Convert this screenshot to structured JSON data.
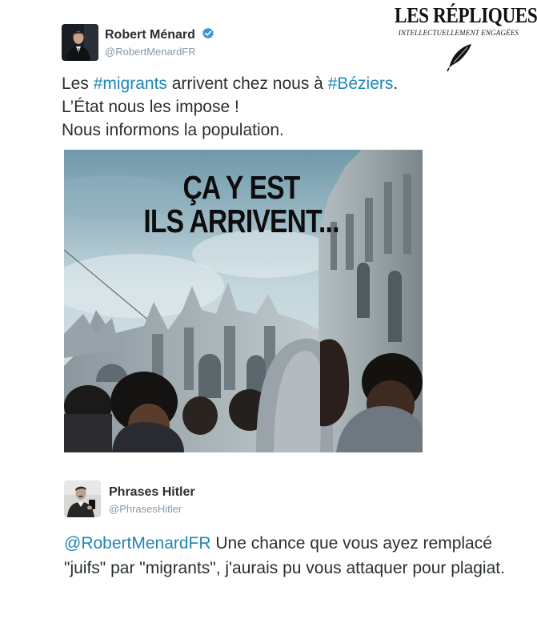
{
  "brand": {
    "title": "LES RÉPLIQUES",
    "subtitle": "INTELLECTUELLEMENT ENGAGÉES",
    "icon": "quill-icon"
  },
  "tweet1": {
    "name": "Robert Ménard",
    "verified_icon": "verified-badge-icon",
    "handle": "@RobertMenardFR",
    "line1_pre": "Les ",
    "line1_tag1": "#migrants",
    "line1_mid": " arrivent chez nous à ",
    "line1_tag2": "#Béziers",
    "line1_post": ".",
    "line2": "L’État nous les impose !",
    "line3": "Nous informons la population.",
    "photo": {
      "headline_line1": "ÇA Y EST",
      "headline_line2": "ILS ARRIVENT..."
    }
  },
  "tweet2": {
    "name": "Phrases Hitler",
    "handle": "@PhrasesHitler",
    "mention": "@RobertMenardFR",
    "text": " Une chance que vous ayez remplacé \"juifs\" par \"migrants\", j'aurais pu vous attaquer pour plagiat."
  },
  "colors": {
    "link": "#1f87b4",
    "text": "#292f33",
    "muted": "#8899a6",
    "verified": "#3b94d9"
  }
}
